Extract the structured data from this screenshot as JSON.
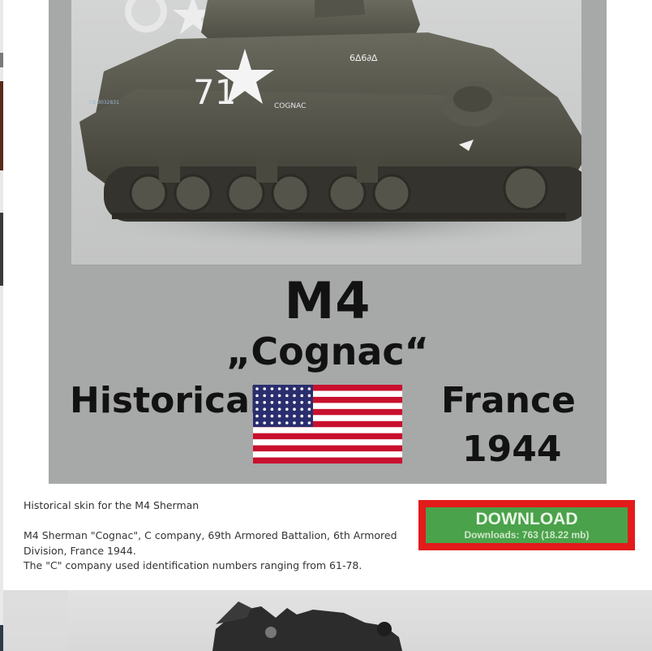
{
  "skin_preview": {
    "model_line": "M4",
    "nickname_line": "„Cognac“",
    "left_word": "Historical",
    "right_word": "France",
    "year": "1944",
    "hull_number": "71",
    "hull_name": "COGNAC",
    "turret_marking": "6∆6∂∆",
    "side_marking": "CB 3032831",
    "flag_icon": "us-flag-48-star-icon"
  },
  "description": {
    "intro": "Historical skin for the M4 Sherman",
    "detail": "M4 Sherman \"Cognac\", C company, 69th Armored Battalion, 6th Armored Division, France 1944.",
    "note": "The \"C\" company used identification numbers ranging from 61-78."
  },
  "download": {
    "label": "DOWNLOAD",
    "count_text": "Downloads: 763 (18.22 mb)"
  },
  "colors": {
    "download_green": "#4aa24a",
    "highlight_red": "#e31b1b",
    "preview_gray": "#a7a8a8",
    "title_text": "#121212"
  }
}
